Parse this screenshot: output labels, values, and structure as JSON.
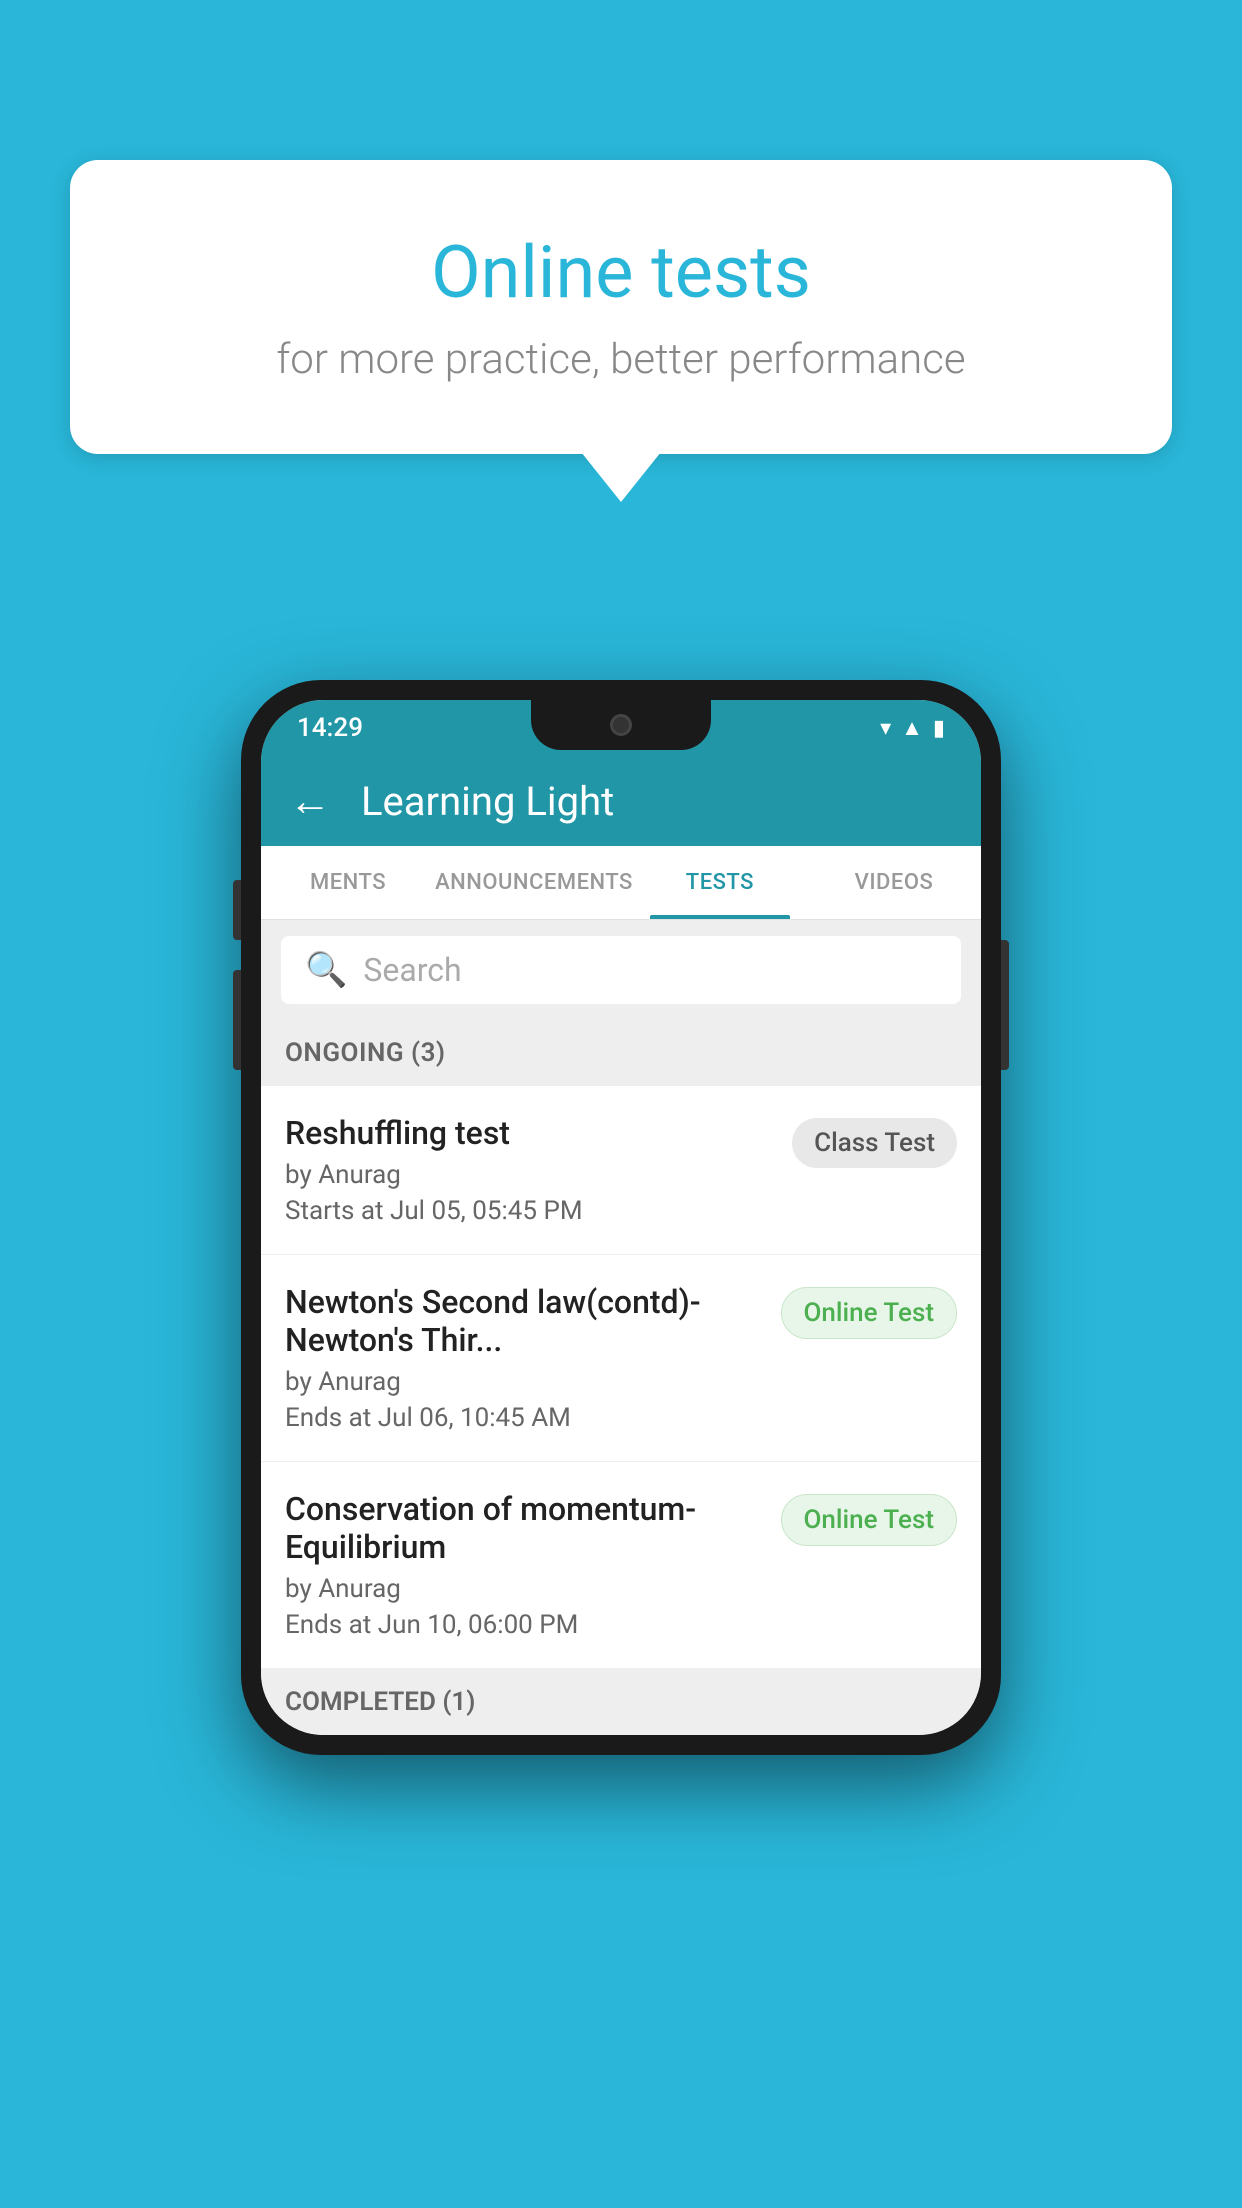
{
  "background_color": "#29b6d8",
  "bubble": {
    "title": "Online tests",
    "subtitle": "for more practice, better performance"
  },
  "phone": {
    "status_bar": {
      "time": "14:29",
      "icons": [
        "wifi",
        "signal",
        "battery"
      ]
    },
    "app_bar": {
      "title": "Learning Light",
      "back_label": "←"
    },
    "tabs": [
      {
        "label": "MENTS",
        "active": false
      },
      {
        "label": "ANNOUNCEMENTS",
        "active": false
      },
      {
        "label": "TESTS",
        "active": true
      },
      {
        "label": "VIDEOS",
        "active": false
      }
    ],
    "search": {
      "placeholder": "Search"
    },
    "ongoing_section": {
      "header": "ONGOING (3)",
      "items": [
        {
          "name": "Reshuffling test",
          "author": "by Anurag",
          "date": "Starts at  Jul 05, 05:45 PM",
          "badge": "Class Test",
          "badge_type": "class"
        },
        {
          "name": "Newton's Second law(contd)-Newton's Thir...",
          "author": "by Anurag",
          "date": "Ends at  Jul 06, 10:45 AM",
          "badge": "Online Test",
          "badge_type": "online"
        },
        {
          "name": "Conservation of momentum-Equilibrium",
          "author": "by Anurag",
          "date": "Ends at  Jun 10, 06:00 PM",
          "badge": "Online Test",
          "badge_type": "online"
        }
      ]
    },
    "completed_section": {
      "header": "COMPLETED (1)"
    }
  }
}
